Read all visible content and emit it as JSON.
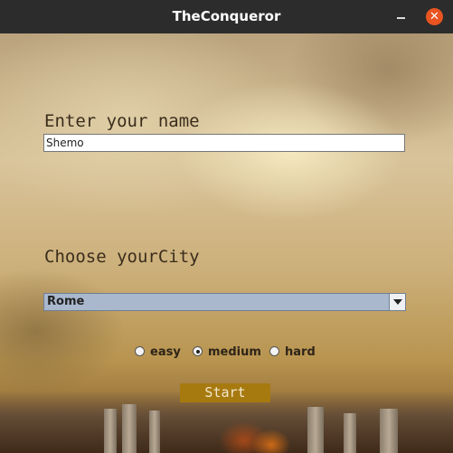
{
  "window": {
    "title": "TheConqueror"
  },
  "name_section": {
    "label": "Enter your name",
    "value": "Shemo"
  },
  "city_section": {
    "label": "Choose yourCity",
    "selected": "Rome"
  },
  "difficulty": {
    "options": [
      {
        "label": "easy",
        "checked": false
      },
      {
        "label": "medium",
        "checked": true
      },
      {
        "label": "hard",
        "checked": false
      }
    ]
  },
  "start_button": {
    "label": "Start"
  },
  "colors": {
    "titlebar": "#2c2c2c",
    "close": "#e95420",
    "start_button": "#a77a10",
    "select_bg": "#a9b8cd"
  }
}
